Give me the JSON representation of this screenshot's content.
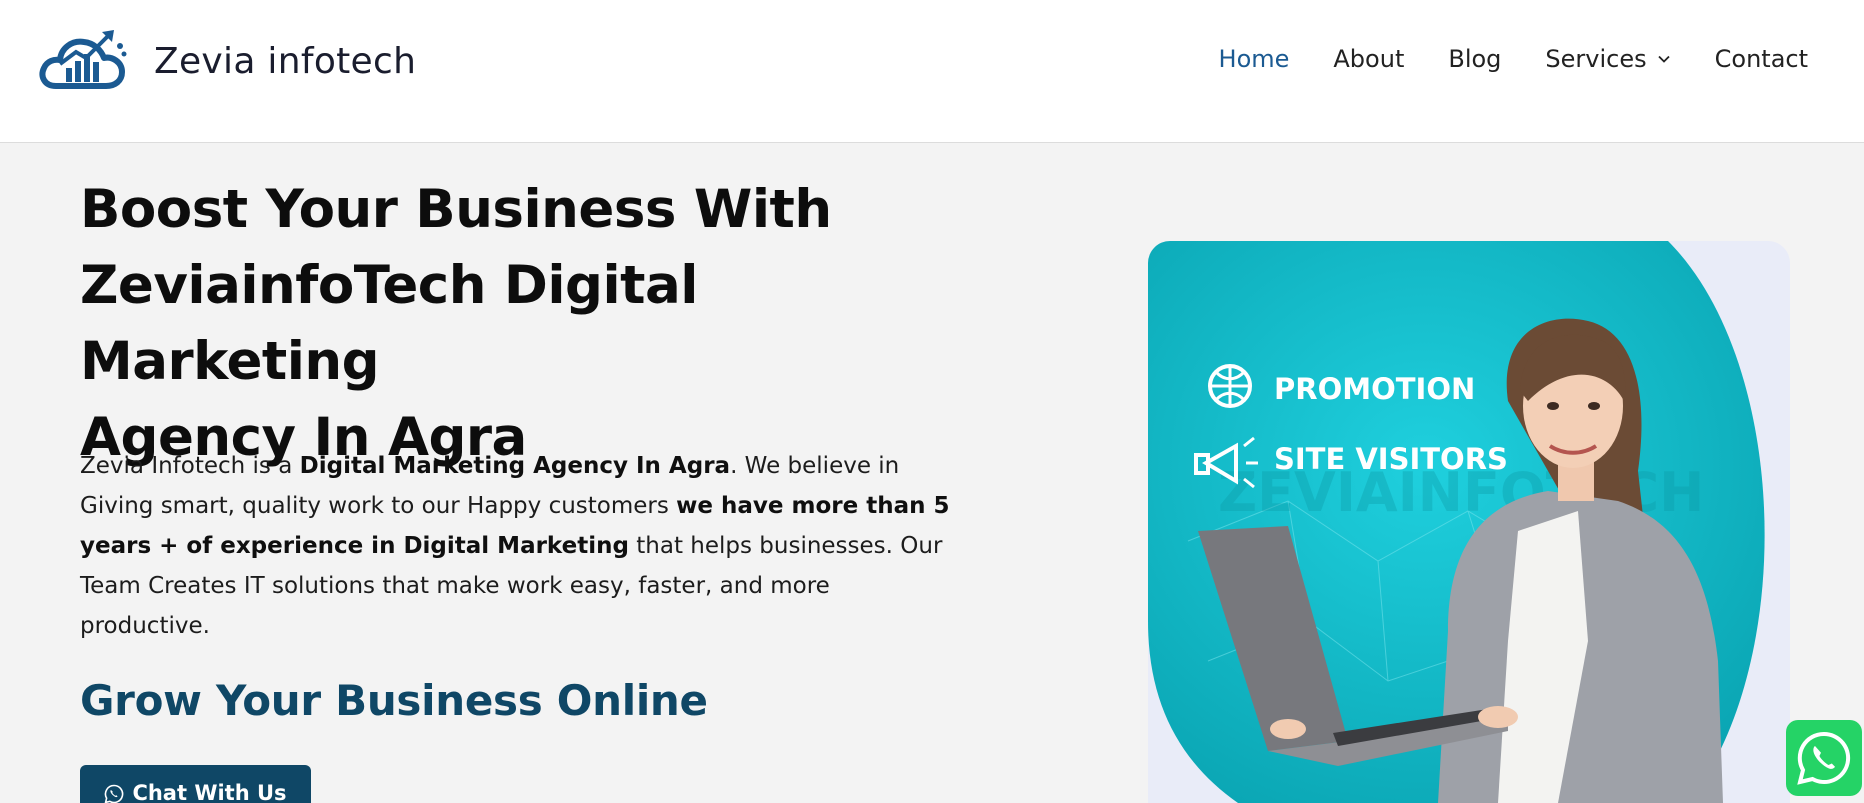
{
  "brand": {
    "name": "Zevia infotech",
    "logo_icon": "cloud-chart-icon",
    "brand_color": "#1b5a92"
  },
  "nav": {
    "items": [
      {
        "label": "Home",
        "active": true
      },
      {
        "label": "About",
        "active": false
      },
      {
        "label": "Blog",
        "active": false
      },
      {
        "label": "Services",
        "active": false,
        "has_dropdown": true
      },
      {
        "label": "Contact",
        "active": false
      }
    ],
    "dropdown_icon": "chevron-down-icon"
  },
  "hero": {
    "title_line1": "Boost Your Business With",
    "title_line2": "ZeviainfoTech Digital Marketing",
    "title_line3": "Agency In Agra",
    "para": {
      "t1": "Zevia Infotech is a ",
      "b1": "Digital Marketing Agency In Agra",
      "t2": ". We believe in Giving smart, quality work to our Happy customers ",
      "b2": "we have more than 5 years + of experience in Digital Marketing",
      "t3": " that helps businesses. Our Team Creates IT solutions that make work easy, faster, and more productive."
    },
    "subheading": "Grow Your Business Online",
    "cta_label": "Chat With Us",
    "cta_icon": "whatsapp-icon"
  },
  "hero_image": {
    "label_promotion": "PROMOTION",
    "label_site_visitors": "SITE VISITORS",
    "watermark": "ZEVIAINFOTECH",
    "teal_color": "#10b8c6"
  },
  "floating": {
    "icon": "whatsapp-icon",
    "color": "#25d366"
  },
  "colors": {
    "accent_dark": "#0f4766",
    "background": "#f3f3f3"
  }
}
